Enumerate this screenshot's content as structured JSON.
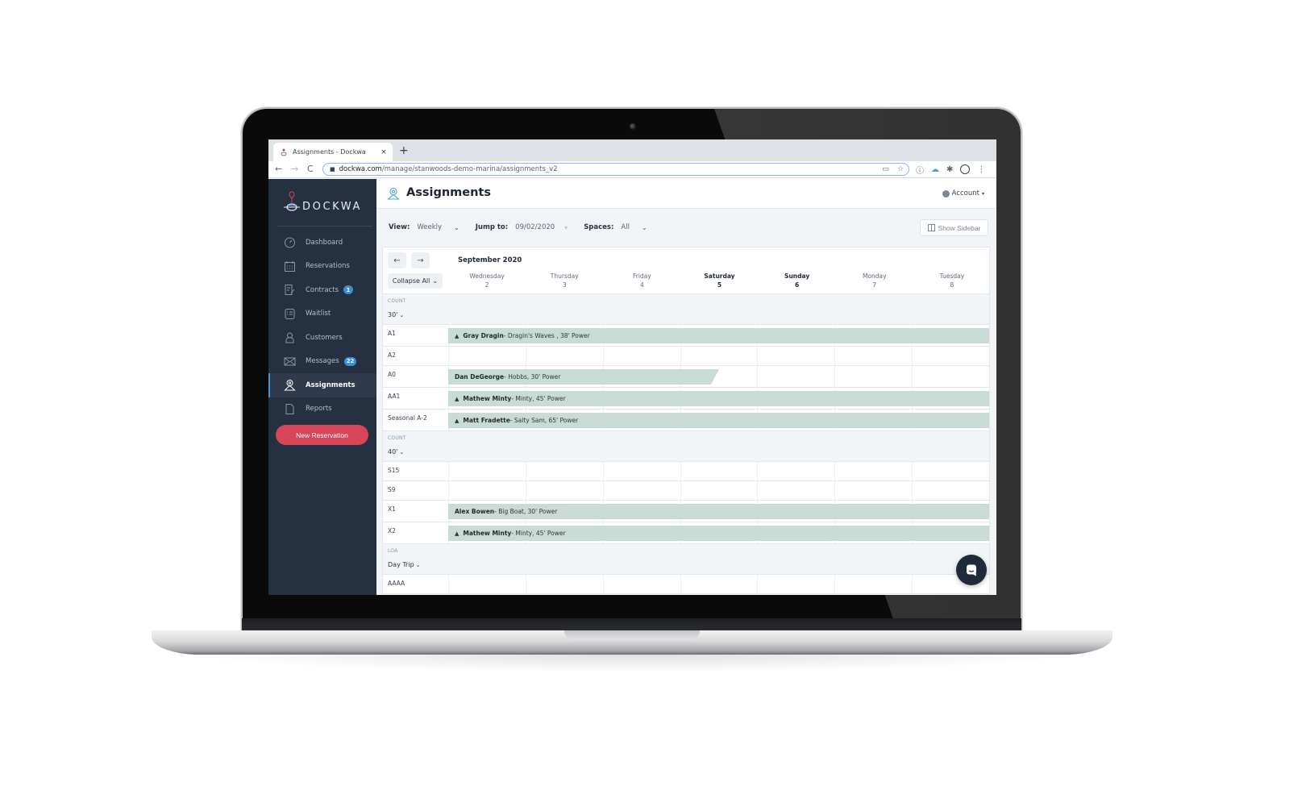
{
  "browser": {
    "tab_title": "Assignments - Dockwa",
    "tab_close": "×",
    "new_tab": "+",
    "url_domain": "dockwa.com",
    "url_path": "/manage/stanwoods-demo-marina/assignments_v2",
    "back": "←",
    "forward": "→",
    "reload": "C"
  },
  "sidebar": {
    "logo_text": "DOCKWA",
    "items": [
      {
        "label": "Dashboard",
        "icon": "dashboard-icon"
      },
      {
        "label": "Reservations",
        "icon": "calendar-icon"
      },
      {
        "label": "Contracts",
        "icon": "contract-icon",
        "badge": "1"
      },
      {
        "label": "Waitlist",
        "icon": "waitlist-icon"
      },
      {
        "label": "Customers",
        "icon": "customer-icon"
      },
      {
        "label": "Messages",
        "icon": "envelope-icon",
        "badge": "22"
      },
      {
        "label": "Assignments",
        "icon": "map-pin-icon",
        "active": true
      },
      {
        "label": "Reports",
        "icon": "document-icon"
      }
    ],
    "new_reservation": "New Reservation"
  },
  "header": {
    "title": "Assignments",
    "account": "Account",
    "account_caret": "▾"
  },
  "filters": {
    "view_label": "View:",
    "view_value": "Weekly",
    "jump_label": "Jump to:",
    "jump_value": "09/02/2020",
    "spaces_label": "Spaces:",
    "spaces_value": "All",
    "show_sidebar": "Show Sidebar"
  },
  "calendar": {
    "month": "September 2020",
    "prev": "←",
    "next": "→",
    "collapse_all": "Collapse All",
    "days": [
      {
        "name": "Wednesday",
        "num": "2",
        "weekend": false
      },
      {
        "name": "Thursday",
        "num": "3",
        "weekend": false
      },
      {
        "name": "Friday",
        "num": "4",
        "weekend": false
      },
      {
        "name": "Saturday",
        "num": "5",
        "weekend": true
      },
      {
        "name": "Sunday",
        "num": "6",
        "weekend": true
      },
      {
        "name": "Monday",
        "num": "7",
        "weekend": false
      },
      {
        "name": "Tuesday",
        "num": "8",
        "weekend": false
      }
    ],
    "groups": [
      {
        "type": "COUNT",
        "value": "30'",
        "spaces": [
          {
            "name": "A1",
            "booking": {
              "guest": "Gray Dragin",
              "details": " - Dragin's Waves , 38' Power",
              "bell": true,
              "partial": false
            }
          },
          {
            "name": "A2"
          },
          {
            "name": "A0",
            "booking": {
              "guest": "Dan DeGeorge",
              "details": " - Hobbs, 30' Power",
              "bell": false,
              "partial": true
            }
          },
          {
            "name": "AA1",
            "booking": {
              "guest": "Mathew Minty",
              "details": " - Minty, 45' Power",
              "bell": true,
              "partial": false
            }
          },
          {
            "name": "Seasonal A-2",
            "booking": {
              "guest": "Matt Fradette",
              "details": " - Salty Sam, 65' Power",
              "bell": true,
              "partial": false
            }
          }
        ]
      },
      {
        "type": "COUNT",
        "value": "40'",
        "spaces": [
          {
            "name": "S15"
          },
          {
            "name": "S9"
          },
          {
            "name": "X1",
            "booking": {
              "guest": "Alex Bowen",
              "details": " - Big Boat, 30' Power",
              "bell": false,
              "partial": false
            }
          },
          {
            "name": "X2",
            "booking": {
              "guest": "Mathew Minty",
              "details": " - Minty, 45' Power",
              "bell": true,
              "partial": false
            }
          }
        ]
      },
      {
        "type": "LOA",
        "value": "Day Trip",
        "spaces": [
          {
            "name": "AAAA"
          }
        ]
      }
    ],
    "expand_more": "⌄"
  },
  "icons": {
    "bell": "🔔",
    "chevron": "⌄",
    "lock": "🔒"
  },
  "colors": {
    "sidebar_bg": "#253040",
    "active_accent": "#3c9ad9",
    "badge": "#3c8fd1",
    "new_reservation": "#d84458",
    "booking_bar": "#c9dbd5"
  }
}
